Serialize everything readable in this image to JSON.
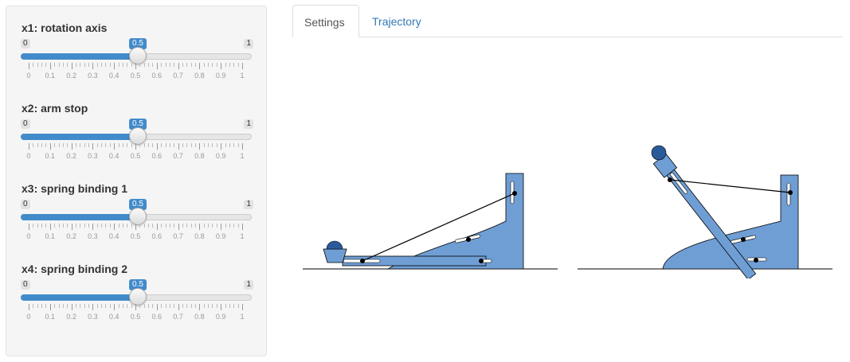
{
  "sliders": [
    {
      "label": "x1: rotation axis",
      "min": "0",
      "max": "1",
      "value": "0.5",
      "fraction": 0.5
    },
    {
      "label": "x2: arm stop",
      "min": "0",
      "max": "1",
      "value": "0.5",
      "fraction": 0.5
    },
    {
      "label": "x3: spring binding 1",
      "min": "0",
      "max": "1",
      "value": "0.5",
      "fraction": 0.5
    },
    {
      "label": "x4: spring binding 2",
      "min": "0",
      "max": "1",
      "value": "0.5",
      "fraction": 0.5
    }
  ],
  "tick_labels": [
    "0",
    "0.1",
    "0.2",
    "0.3",
    "0.4",
    "0.5",
    "0.6",
    "0.7",
    "0.8",
    "0.9",
    "1"
  ],
  "tabs": {
    "settings": "Settings",
    "trajectory": "Trajectory"
  },
  "colors": {
    "accent": "#428bca",
    "machine_fill": "#6f9ed4",
    "ball": "#2b5a9a",
    "link": "#337ab7"
  }
}
